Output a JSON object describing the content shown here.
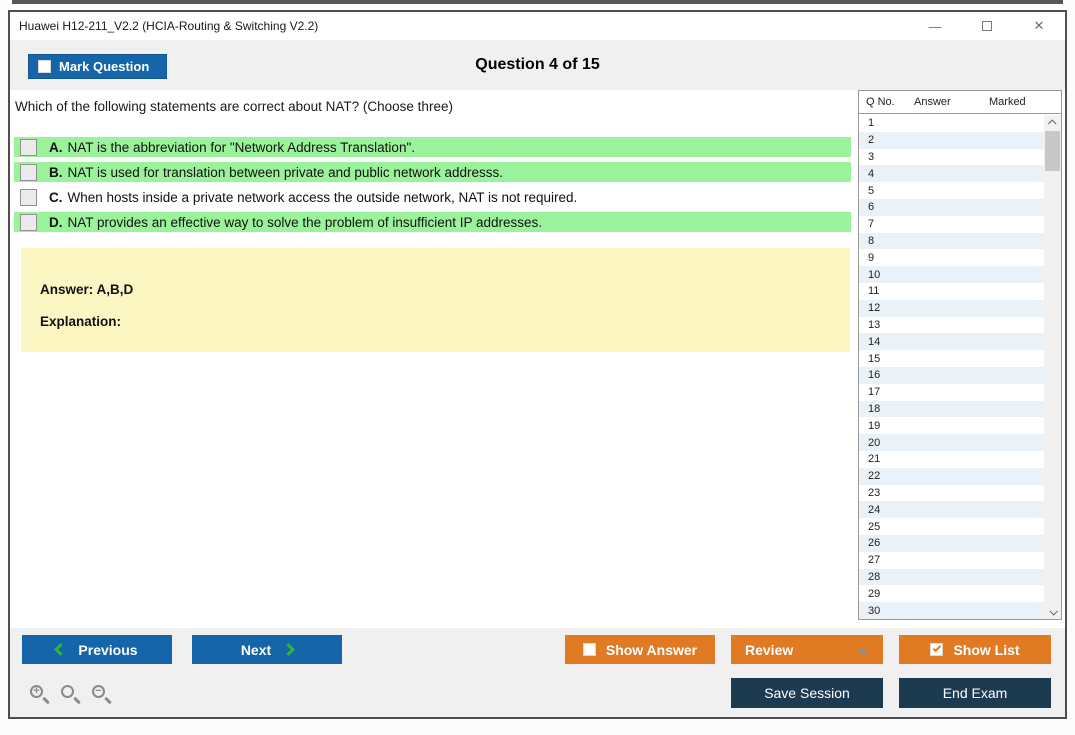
{
  "window": {
    "title": "Huawei H12-211_V2.2 (HCIA-Routing & Switching V2.2)",
    "controls": {
      "minimize": "—",
      "close": "✕"
    }
  },
  "header": {
    "mark_question_label": "Mark Question",
    "question_counter": "Question 4 of 15"
  },
  "question": {
    "text": "Which of the following statements are correct about NAT? (Choose three)",
    "options": [
      {
        "letter": "A.",
        "text": "NAT is the abbreviation for \"Network Address Translation\".",
        "highlighted": true,
        "checked": false
      },
      {
        "letter": "B.",
        "text": "NAT is used for translation between private and public network addresss.",
        "highlighted": true,
        "checked": false
      },
      {
        "letter": "C.",
        "text": "When hosts inside a private network access the outside network, NAT is not required.",
        "highlighted": false,
        "checked": false
      },
      {
        "letter": "D.",
        "text": "NAT provides an effective way to solve the problem of insufficient IP addresses.",
        "highlighted": true,
        "checked": false
      }
    ]
  },
  "answer_panel": {
    "answer": "Answer: A,B,D",
    "explanation": "Explanation:"
  },
  "question_list": {
    "columns": [
      "Q No.",
      "Answer",
      "Marked"
    ],
    "question_numbers": [
      1,
      2,
      3,
      4,
      5,
      6,
      7,
      8,
      9,
      10,
      11,
      12,
      13,
      14,
      15,
      16,
      17,
      18,
      19,
      20,
      21,
      22,
      23,
      24,
      25,
      26,
      27,
      28,
      29,
      30
    ],
    "scrollbar": {
      "up_icon": "up-arrow",
      "down_icon": "down-arrow"
    }
  },
  "footer": {
    "previous_label": "Previous",
    "next_label": "Next",
    "show_answer_label": "Show Answer",
    "review_label": "Review",
    "show_list_label": "Show List",
    "save_session_label": "Save Session",
    "end_exam_label": "End Exam",
    "zoom_icons": [
      "zoom-in",
      "zoom",
      "zoom-out"
    ]
  },
  "states": {
    "mark_question_checked": false,
    "show_answer_checked": false,
    "show_list_checked": true
  },
  "colors": {
    "accent_blue": "#1565a8",
    "accent_orange": "#e07b24",
    "navy": "#1c3a50",
    "highlight_green": "#9af29a",
    "answer_yellow": "#fcf6c3",
    "list_alt_row": "#eaf2f8",
    "chevron_green": "#2eb834"
  }
}
